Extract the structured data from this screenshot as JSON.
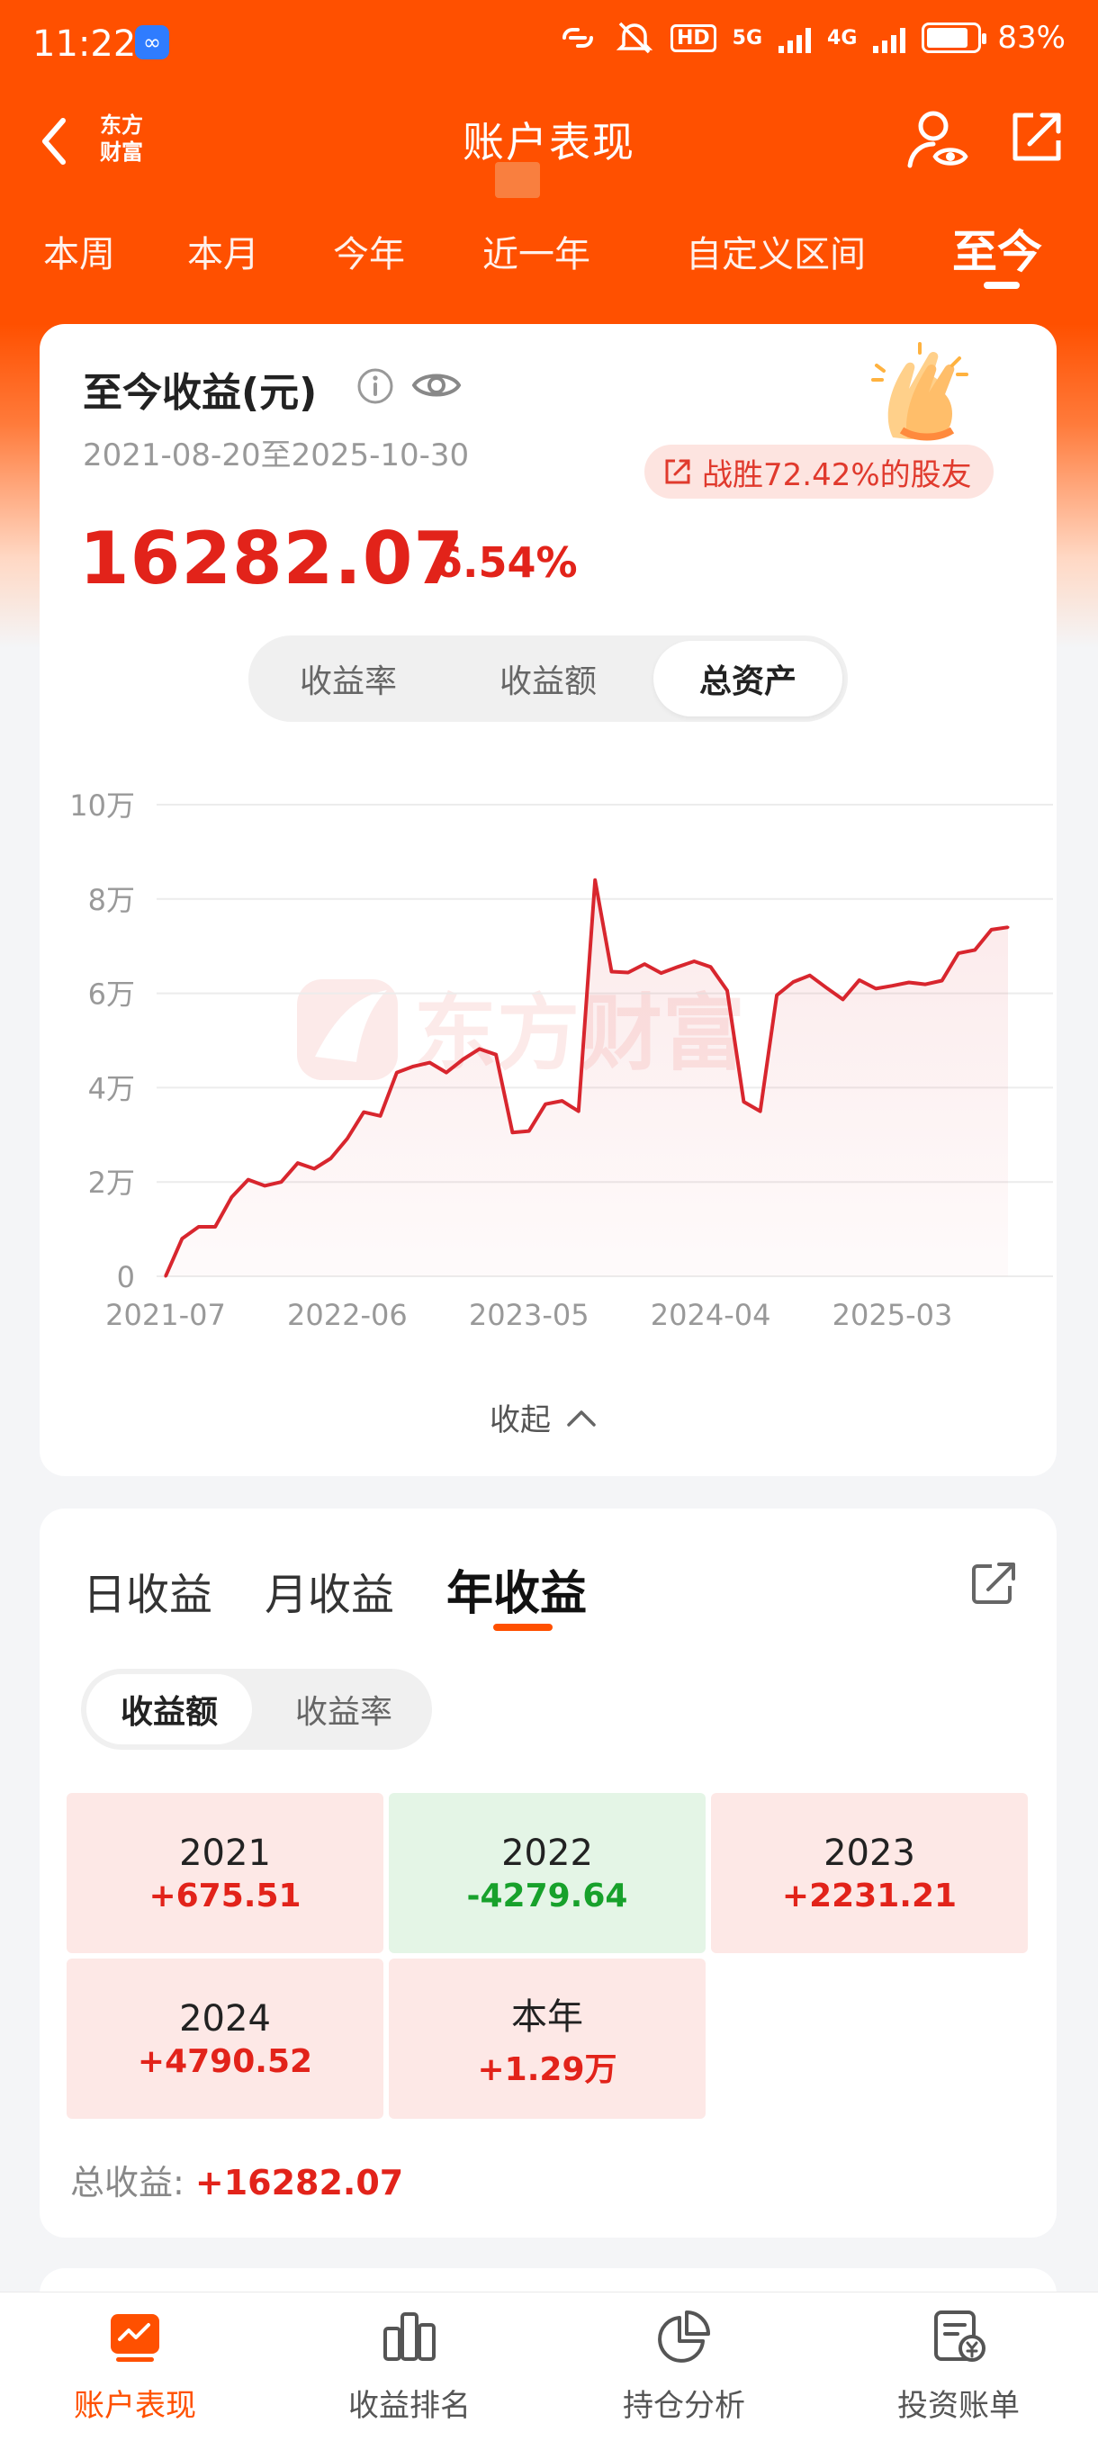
{
  "status_bar": {
    "time": "11:22",
    "network_hd": "HD",
    "network_5g": "5G",
    "network_4g": "4G",
    "battery": "83%",
    "battery_level": 0.83
  },
  "header": {
    "logo_line1": "东方",
    "logo_line2": "财富",
    "title": "账户表现"
  },
  "period_tabs": [
    {
      "label": "本周",
      "active": false
    },
    {
      "label": "本月",
      "active": false
    },
    {
      "label": "今年",
      "active": false
    },
    {
      "label": "近一年",
      "active": false
    },
    {
      "label": "自定义区间",
      "active": false
    },
    {
      "label": "至今",
      "active": true
    }
  ],
  "summary": {
    "title": "至今收益(元)",
    "date_range": "2021-08-20至2025-10-30",
    "beat_text": "战胜72.42%的股友",
    "profit_amount": "16282.07",
    "profit_rate": "6.54%",
    "segments": [
      "收益率",
      "收益额",
      "总资产"
    ],
    "active_segment": 2,
    "collapse_label": "收起",
    "watermark": "东方财富"
  },
  "chart_data": {
    "type": "area",
    "title": "",
    "xlabel": "",
    "ylabel": "",
    "ylim": [
      0,
      100000
    ],
    "yticks": [
      {
        "value": 0,
        "label": "0"
      },
      {
        "value": 20000,
        "label": "2万"
      },
      {
        "value": 40000,
        "label": "4万"
      },
      {
        "value": 60000,
        "label": "6万"
      },
      {
        "value": 80000,
        "label": "8万"
      },
      {
        "value": 100000,
        "label": "10万"
      }
    ],
    "xlim": [
      "2021-07",
      "2025-10"
    ],
    "xticks": [
      "2021-07",
      "2022-06",
      "2023-05",
      "2024-04",
      "2025-03"
    ],
    "grid": true,
    "color": "#d8262e",
    "series": [
      {
        "x": [
          "2021-07",
          "2021-08",
          "2021-09",
          "2021-10",
          "2021-11",
          "2021-12",
          "2022-01",
          "2022-02",
          "2022-03",
          "2022-04",
          "2022-05",
          "2022-06",
          "2022-07",
          "2022-08",
          "2022-09",
          "2022-10",
          "2022-11",
          "2022-12",
          "2023-01",
          "2023-02",
          "2023-03",
          "2023-04",
          "2023-05",
          "2023-06",
          "2023-07",
          "2023-08",
          "2023-09",
          "2023-10",
          "2023-11",
          "2023-12",
          "2024-01",
          "2024-02",
          "2024-03",
          "2024-04",
          "2024-05",
          "2024-06",
          "2024-07",
          "2024-08",
          "2024-09",
          "2024-10",
          "2024-11",
          "2024-12",
          "2025-01",
          "2025-02",
          "2025-03",
          "2025-04",
          "2025-05",
          "2025-06",
          "2025-07",
          "2025-08",
          "2025-09",
          "2025-10"
        ],
        "y": [
          0,
          8000,
          10500,
          10500,
          16800,
          20500,
          19200,
          20000,
          24000,
          22800,
          25000,
          29200,
          34800,
          34000,
          43200,
          44500,
          45300,
          43200,
          46000,
          48200,
          47000,
          30500,
          30800,
          36500,
          37200,
          35000,
          84000,
          64600,
          64400,
          66200,
          64300,
          65600,
          66800,
          65600,
          60600,
          37000,
          35000,
          59600,
          62400,
          63800,
          61200,
          58700,
          62800,
          61000,
          61600,
          62300,
          61900,
          62700,
          68500,
          69200,
          73500,
          74000
        ]
      }
    ]
  },
  "yearly": {
    "tabs": [
      "日收益",
      "月收益",
      "年收益"
    ],
    "active_tab": 2,
    "segments": [
      "收益额",
      "收益率"
    ],
    "active_segment": 0,
    "cells": [
      {
        "year": "2021",
        "value": "+675.51",
        "trend": "up"
      },
      {
        "year": "2022",
        "value": "-4279.64",
        "trend": "down"
      },
      {
        "year": "2023",
        "value": "+2231.21",
        "trend": "up"
      },
      {
        "year": "2024",
        "value": "+4790.52",
        "trend": "up"
      },
      {
        "year": "本年",
        "value": "+1.29万",
        "trend": "up"
      }
    ],
    "total_label": "总收益: ",
    "total_value": "+16282.07"
  },
  "bottom_nav": [
    {
      "label": "账户表现",
      "icon": "account-performance-icon",
      "active": true
    },
    {
      "label": "收益排名",
      "icon": "ranking-icon",
      "active": false
    },
    {
      "label": "持仓分析",
      "icon": "pie-chart-icon",
      "active": false
    },
    {
      "label": "投资账单",
      "icon": "bill-icon",
      "active": false
    }
  ],
  "colors": {
    "brand": "#ff5000",
    "up": "#e2231a",
    "down": "#17a12b"
  }
}
